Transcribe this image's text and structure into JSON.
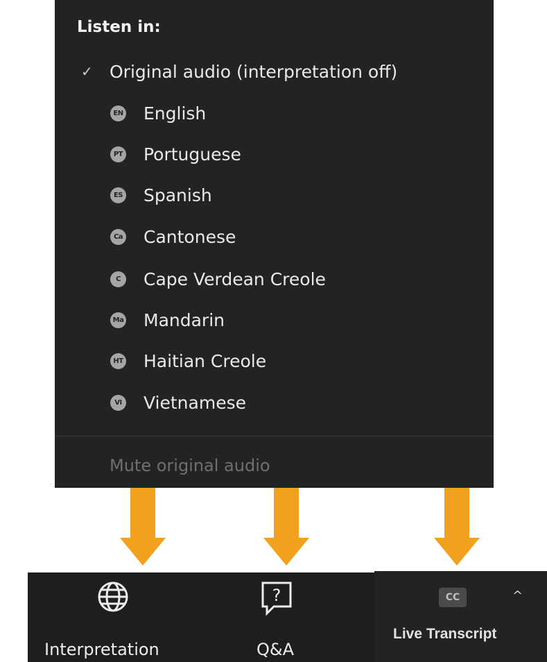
{
  "menu": {
    "title": "Listen in:",
    "original": {
      "label": "Original audio (interpretation off)",
      "checked": true,
      "check_glyph": "✓"
    },
    "languages": [
      {
        "code": "EN",
        "label": "English"
      },
      {
        "code": "PT",
        "label": "Portuguese"
      },
      {
        "code": "ES",
        "label": "Spanish"
      },
      {
        "code": "Ca",
        "label": "Cantonese"
      },
      {
        "code": "C",
        "label": "Cape Verdean Creole"
      },
      {
        "code": "Ma",
        "label": "Mandarin"
      },
      {
        "code": "HT",
        "label": "Haitian Creole"
      },
      {
        "code": "VI",
        "label": "Vietnamese"
      }
    ],
    "mute_label": "Mute original audio"
  },
  "toolbar": {
    "interpretation_label": "Interpretation",
    "interpretation_icon": "globe-icon",
    "qa_label": "Q&A",
    "qa_icon": "question-bubble-icon",
    "qa_glyph": "?",
    "transcript_label": "Live Transcript",
    "cc_label": "CC",
    "caret_glyph": "^"
  },
  "colors": {
    "menu_bg": "#232323",
    "toolbar_bg": "#1e1e1e",
    "arrow": "#f2a11f",
    "badge": "#a5a5a5",
    "muted_text": "#6f6f6f"
  }
}
